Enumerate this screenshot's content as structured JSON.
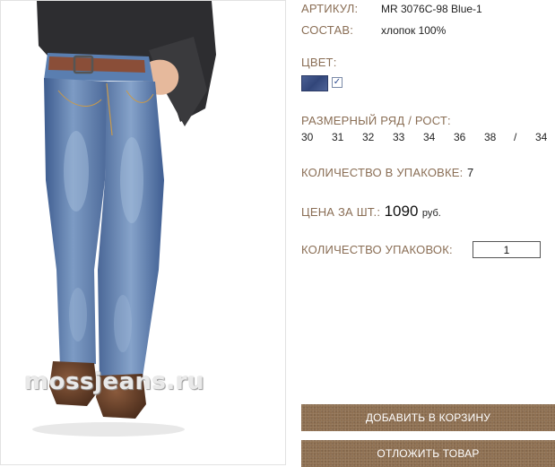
{
  "product": {
    "article_label": "АРТИКУЛ:",
    "article_value": "MR 3076C-98 Blue-1",
    "composition_label": "СОСТАВ:",
    "composition_value": "хлопок 100%",
    "color_label": "ЦВЕТ:",
    "color_swatch": "#3b4f86",
    "color_checked_glyph": "✓",
    "size_label": "РАЗМЕРНЫЙ РЯД / РОСТ:",
    "sizes": [
      "30",
      "31",
      "32",
      "33",
      "34",
      "36",
      "38"
    ],
    "size_separator": "/",
    "height": "34",
    "pack_qty_label": "КОЛИЧЕСТВО В УПАКОВКЕ:",
    "pack_qty_value": "7",
    "price_label": "ЦЕНА ЗА ШТ.:",
    "price_value": "1090",
    "price_currency": "руб.",
    "packs_label": "КОЛИЧЕСТВО УПАКОВОК:",
    "packs_value": "1"
  },
  "image": {
    "watermark": "mossjeans.ru",
    "subject": "jeans-photo"
  },
  "buttons": {
    "add_to_cart": "ДОБАВИТЬ В КОРЗИНУ",
    "postpone": "ОТЛОЖИТЬ ТОВАР"
  },
  "colors": {
    "label_brown": "#8a6e55",
    "button_brown": "#8f7052"
  }
}
